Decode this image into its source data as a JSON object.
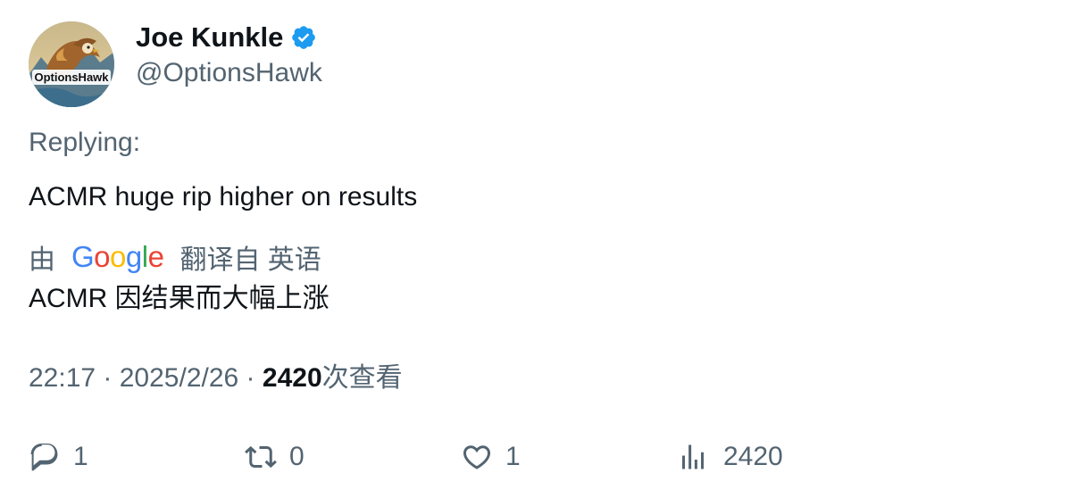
{
  "author": {
    "name": "Joe Kunkle",
    "handle": "@OptionsHawk",
    "avatar_text": "OptionsHawk",
    "verified": true
  },
  "tweet": {
    "replying_label": "Replying:",
    "text": "ACMR huge rip higher on results"
  },
  "translation": {
    "by_label": "由",
    "provider": "Google",
    "from_label": "翻译自 英语",
    "text": "ACMR 因结果而大幅上涨"
  },
  "meta": {
    "time": "22:17",
    "separator": " · ",
    "date": "2025/2/26",
    "views_count": "2420",
    "views_label": "次查看"
  },
  "actions": {
    "reply_count": "1",
    "retweet_count": "0",
    "like_count": "1",
    "views_count": "2420"
  },
  "colors": {
    "verified": "#1d9bf0",
    "secondary_text": "#536471",
    "primary_text": "#0f1419"
  },
  "icons": {
    "reply": "reply-icon",
    "retweet": "retweet-icon",
    "like": "heart-icon",
    "views": "bar-chart-icon",
    "verified": "verified-badge-icon"
  }
}
